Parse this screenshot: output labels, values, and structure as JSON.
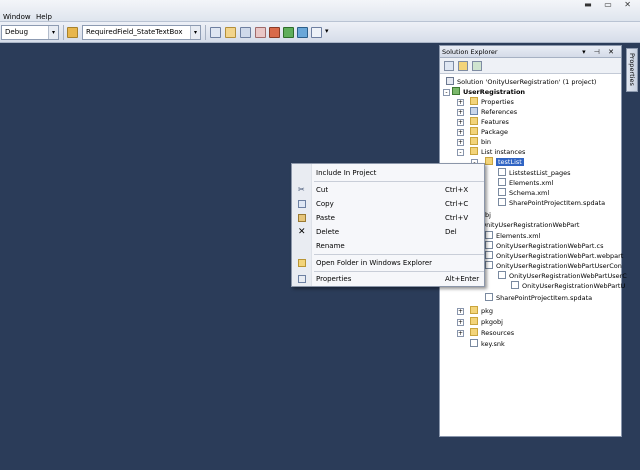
{
  "menubar": {
    "items": [
      "Window",
      "Help"
    ],
    "window_controls": "▬ ▭ ✕"
  },
  "toolbar": {
    "config_combo": "Debug",
    "find_combo": "RequiredField_StateTextBox",
    "dropdown_glyph": "▾"
  },
  "solution_explorer": {
    "title": "Solution Explorer",
    "title_controls": "▾ ⊣ ✕",
    "tree": [
      {
        "label": "Solution 'OnityUserRegistration' (1 project)",
        "icon": "solution-icon"
      },
      {
        "label": "UserRegistration",
        "icon": "project-icon"
      },
      {
        "label": "Properties",
        "icon": "folder-icon"
      },
      {
        "label": "References",
        "icon": "references-icon"
      },
      {
        "label": "Features",
        "icon": "folder-icon"
      },
      {
        "label": "Package",
        "icon": "folder-icon"
      },
      {
        "label": "bin",
        "icon": "folder-icon"
      },
      {
        "label": "List instances",
        "icon": "folder-icon"
      },
      {
        "label": "testList",
        "icon": "folder-icon"
      },
      {
        "label": "ListstestList_pages",
        "icon": "file-icon"
      },
      {
        "label": "Elements.xml",
        "icon": "file-icon"
      },
      {
        "label": "Schema.xml",
        "icon": "file-icon"
      },
      {
        "label": "SharePointProjectItem.spdata",
        "icon": "file-icon"
      },
      {
        "label": "obj",
        "icon": "folder-icon"
      },
      {
        "label": "OnityUserRegistrationWebPart",
        "icon": "folder-icon"
      },
      {
        "label": "Elements.xml",
        "icon": "file-icon"
      },
      {
        "label": "OnityUserRegistrationWebPart.cs",
        "icon": "file-icon"
      },
      {
        "label": "OnityUserRegistrationWebPart.webpart",
        "icon": "file-icon"
      },
      {
        "label": "OnityUserRegistrationWebPartUserCon",
        "icon": "file-icon"
      },
      {
        "label": "OnityUserRegistrationWebPartUserC",
        "icon": "file-icon"
      },
      {
        "label": "OnityUserRegistrationWebPartU",
        "icon": "file-icon"
      },
      {
        "label": "SharePointProjectItem.spdata",
        "icon": "file-icon"
      },
      {
        "label": "pkg",
        "icon": "folder-icon"
      },
      {
        "label": "pkgobj",
        "icon": "folder-icon"
      },
      {
        "label": "Resources",
        "icon": "folder-icon"
      },
      {
        "label": "key.snk",
        "icon": "file-icon"
      }
    ]
  },
  "properties_tab": {
    "label": "Properties"
  },
  "context_menu": {
    "items": [
      {
        "label": "Include In Project",
        "shortcut": ""
      },
      {
        "label": "Cut",
        "shortcut": "Ctrl+X"
      },
      {
        "label": "Copy",
        "shortcut": "Ctrl+C"
      },
      {
        "label": "Paste",
        "shortcut": "Ctrl+V"
      },
      {
        "label": "Delete",
        "shortcut": "Del"
      },
      {
        "label": "Rename",
        "shortcut": ""
      },
      {
        "label": "Open Folder in Windows Explorer",
        "shortcut": ""
      },
      {
        "label": "Properties",
        "shortcut": "Alt+Enter"
      }
    ]
  }
}
